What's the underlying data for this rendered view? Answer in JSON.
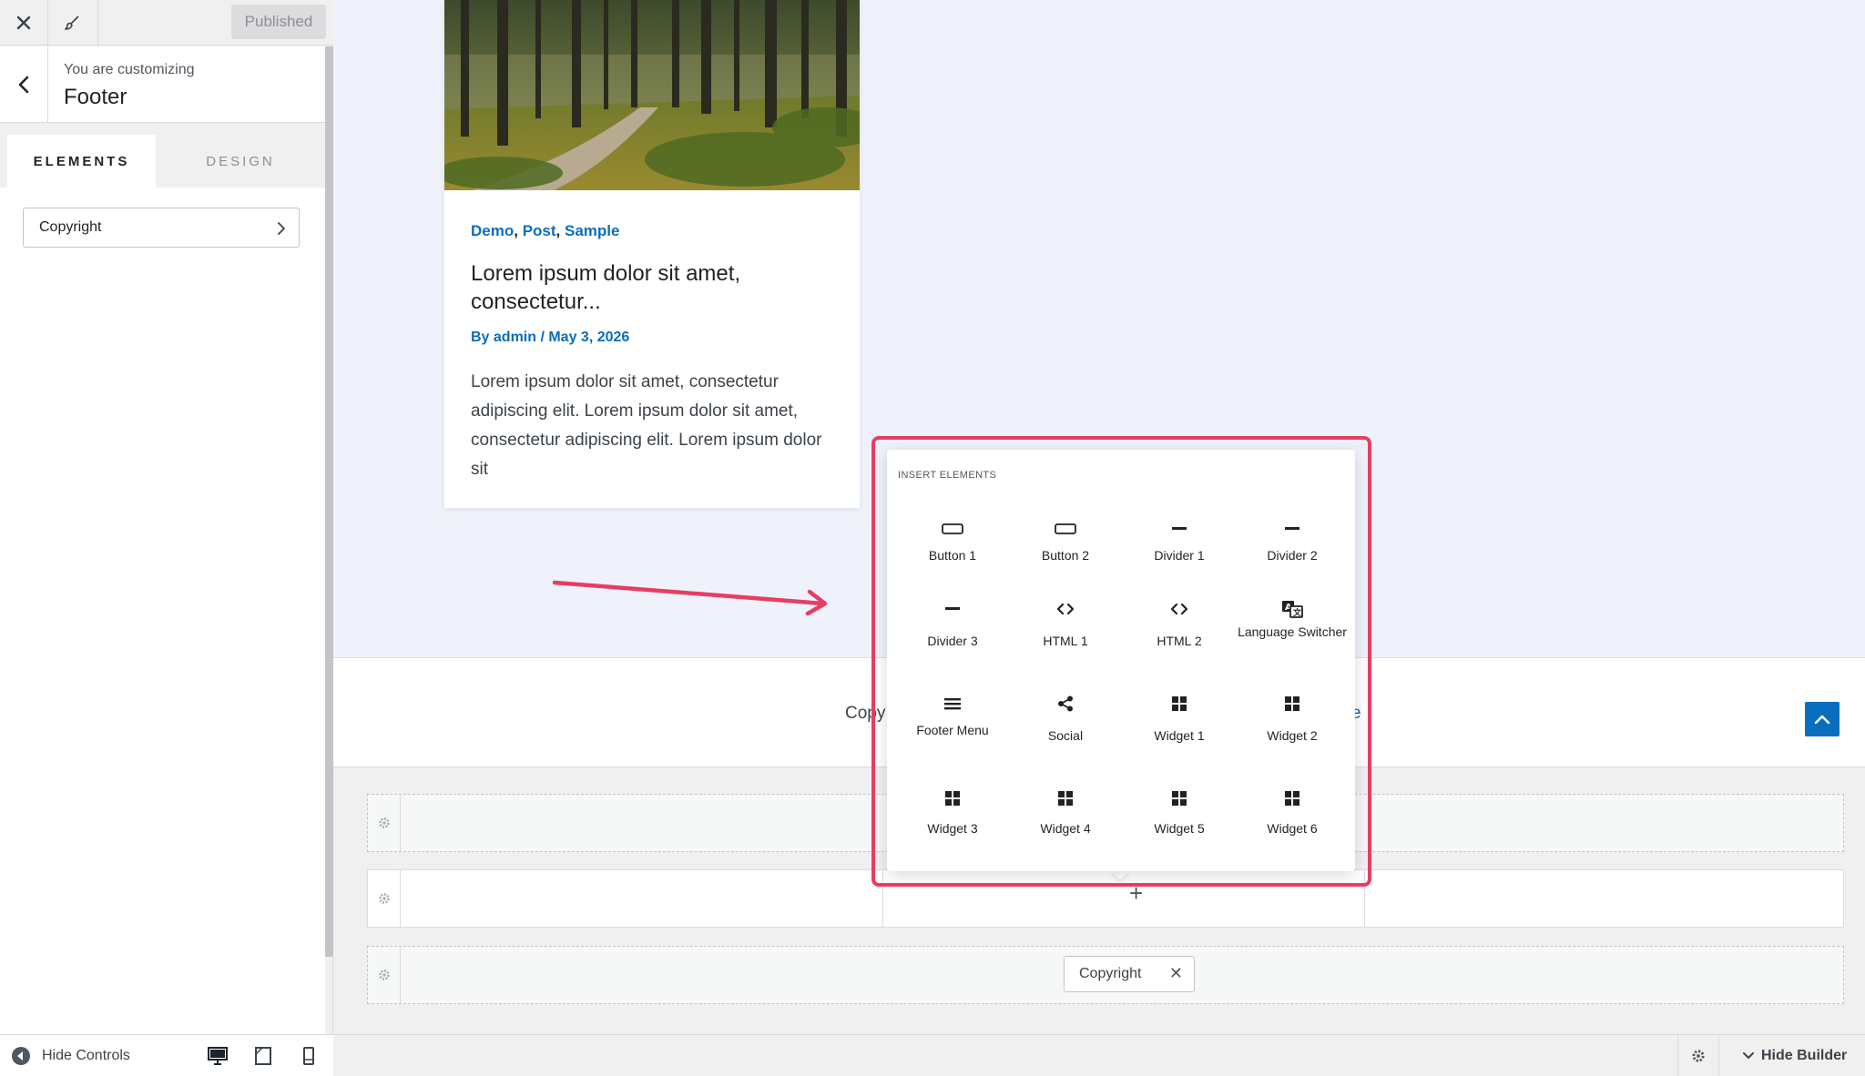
{
  "sidebar": {
    "published_label": "Published",
    "customizing_label": "You are customizing",
    "section_title": "Footer",
    "tabs": [
      {
        "label": "ELEMENTS",
        "active": true
      },
      {
        "label": "DESIGN",
        "active": false
      }
    ],
    "items": [
      {
        "label": "Copyright"
      }
    ],
    "hide_controls_label": "Hide Controls"
  },
  "preview": {
    "categories": [
      "Demo",
      "Post",
      "Sample"
    ],
    "post_title": "Lorem ipsum dolor sit amet, consectetur...",
    "meta": "By admin / May 3, 2026",
    "excerpt": "Lorem ipsum dolor sit amet, consectetur adipiscing elit. Lorem ipsum dolor sit amet, consectetur adipiscing elit. Lorem ipsum dolor sit",
    "footer_copy_visible": "Copy",
    "footer_link_visible": "e"
  },
  "builder": {
    "copyright_chip": "Copyright",
    "hide_builder_label": "Hide Builder"
  },
  "popup": {
    "heading": "INSERT ELEMENTS",
    "elements": [
      {
        "label": "Button 1",
        "icon": "button-icon"
      },
      {
        "label": "Button 2",
        "icon": "button-icon"
      },
      {
        "label": "Divider 1",
        "icon": "divider-icon"
      },
      {
        "label": "Divider 2",
        "icon": "divider-icon"
      },
      {
        "label": "Divider 3",
        "icon": "divider-icon"
      },
      {
        "label": "HTML 1",
        "icon": "code-icon"
      },
      {
        "label": "HTML 2",
        "icon": "code-icon"
      },
      {
        "label": "Language Switcher",
        "icon": "translate-icon"
      },
      {
        "label": "Footer Menu",
        "icon": "menu-icon"
      },
      {
        "label": "Social",
        "icon": "share-icon"
      },
      {
        "label": "Widget 1",
        "icon": "widget-icon"
      },
      {
        "label": "Widget 2",
        "icon": "widget-icon"
      },
      {
        "label": "Widget 3",
        "icon": "widget-icon"
      },
      {
        "label": "Widget 4",
        "icon": "widget-icon"
      },
      {
        "label": "Widget 5",
        "icon": "widget-icon"
      },
      {
        "label": "Widget 6",
        "icon": "widget-icon"
      }
    ]
  },
  "colors": {
    "accent": "#0a6ebd",
    "highlight": "#e83d63"
  }
}
